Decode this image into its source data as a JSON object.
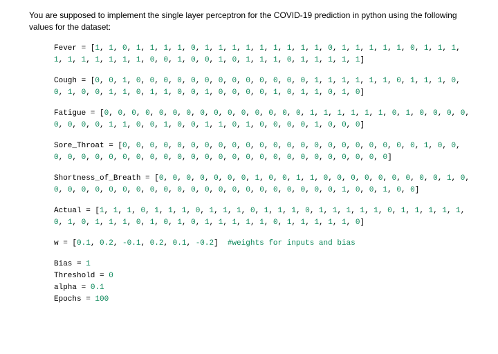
{
  "intro": "You are supposed to implement the single layer perceptron for the COVID-19 prediction in python using the following values for the dataset:",
  "lines": {
    "fever": "Fever = [1, 1, 0, 1, 1, 1, 1, 0, 1, 1, 1, 1, 1, 1, 1, 1, 1, 0, 1, 1, 1, 1, 1, 0, 1, 1, 1, 1, 1, 1, 1, 1, 1, 1, 0, 0, 1, 0, 0, 1, 0, 1, 1, 1, 0, 1, 1, 1, 1, 1]",
    "cough": "Cough = [0, 0, 1, 0, 0, 0, 0, 0, 0, 0, 0, 0, 0, 0, 0, 0, 1, 1, 1, 1, 1, 1, 0, 1, 1, 1, 0, 0, 1, 0, 0, 1, 1, 0, 1, 1, 0, 0, 1, 0, 0, 0, 0, 1, 0, 1, 1, 0, 1, 0]",
    "fatigue": "Fatigue = [0, 0, 0, 0, 0, 0, 0, 0, 0, 0, 0, 0, 0, 0, 0, 1, 1, 1, 1, 1, 1, 0, 1, 0, 0, 0, 0, 0, 0, 0, 0, 1, 1, 0, 0, 1, 0, 0, 1, 1, 0, 1, 0, 0, 0, 0, 1, 0, 0, 0]",
    "sore_throat": "Sore_Throat = [0, 0, 0, 0, 0, 0, 0, 0, 0, 0, 0, 0, 0, 0, 0, 0, 0, 0, 0, 0, 0, 0, 1, 0, 0, 0, 0, 0, 0, 0, 0, 0, 0, 0, 0, 0, 0, 0, 0, 0, 0, 0, 0, 0, 0, 0, 0, 0, 0, 0]",
    "shortness": "Shortness_of_Breath = [0, 0, 0, 0, 0, 0, 0, 1, 0, 0, 1, 1, 0, 0, 0, 0, 0, 0, 0, 0, 0, 1, 0, 0, 0, 0, 0, 0, 0, 0, 0, 0, 0, 0, 0, 0, 0, 0, 0, 0, 0, 0, 0, 0, 1, 0, 0, 1, 0, 0]",
    "actual": "Actual = [1, 1, 1, 0, 1, 1, 1, 0, 1, 1, 1, 0, 1, 1, 1, 0, 1, 1, 1, 1, 1, 0, 1, 1, 1, 1, 1, 0, 1, 0, 1, 1, 1, 0, 1, 0, 1, 0, 1, 1, 1, 1, 1, 0, 1, 1, 1, 1, 1, 0]",
    "weights": "w = [0.1, 0.2, -0.1, 0.2, 0.1, -0.2]  #weights for inputs and bias",
    "bias": "Bias = 1",
    "threshold": "Threshold = 0",
    "alpha": "alpha = 0.1",
    "epochs": "Epochs = 100"
  }
}
